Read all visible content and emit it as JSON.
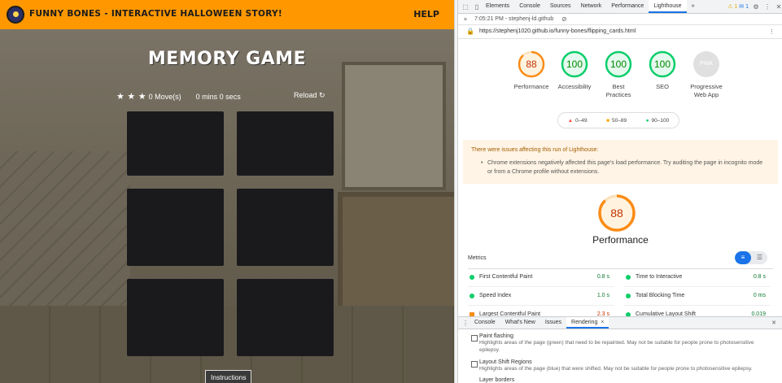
{
  "game": {
    "site_title": "Funny Bones - Interactive Halloween Story!",
    "help": "HELP",
    "title": "MEMORY GAME",
    "stars": [
      "★",
      "★",
      "★"
    ],
    "moves": "0 Move(s)",
    "timer": "0 mins 0 secs",
    "reload": "Reload ↻",
    "card_count": 6,
    "instructions_button": "Instructions"
  },
  "devtools": {
    "tabs": [
      "Elements",
      "Console",
      "Sources",
      "Network",
      "Performance",
      "Lighthouse"
    ],
    "active_tab": "Lighthouse",
    "more_tabs": "»",
    "warn_badge": "⚠ 1",
    "info_badge": "✉ 1",
    "report_time": "7:05:21 PM - stephenj-ld.github",
    "url": "https://stephenj1020.github.io/funny-bones/flipping_cards.html",
    "gauges": [
      {
        "score": "88",
        "label": "Performance",
        "color": "#fa8c16"
      },
      {
        "score": "100",
        "label": "Accessibility",
        "color": "#0cce6b"
      },
      {
        "score": "100",
        "label": "Best Practices",
        "color": "#0cce6b"
      },
      {
        "score": "100",
        "label": "SEO",
        "color": "#0cce6b"
      },
      {
        "score": "PWA",
        "label": "Progressive Web App",
        "color": "#cccccc"
      }
    ],
    "legend": {
      "low": "0–49",
      "mid": "50–89",
      "high": "90–100"
    },
    "warning_title": "There were issues affecting this run of Lighthouse:",
    "warning_item": "Chrome extensions negatively affected this page's load performance. Try auditing the page in incognito mode or from a Chrome profile without extensions.",
    "performance_score": "88",
    "performance_label": "Performance",
    "metrics_label": "Metrics",
    "metrics": [
      {
        "label": "First Contentful Paint",
        "value": "0.8 s",
        "color": "#0cce6b"
      },
      {
        "label": "Time to Interactive",
        "value": "0.8 s",
        "color": "#0cce6b"
      },
      {
        "label": "Speed Index",
        "value": "1.0 s",
        "color": "#0cce6b"
      },
      {
        "label": "Total Blocking Time",
        "value": "0 ms",
        "color": "#0cce6b"
      },
      {
        "label": "Largest Contentful Paint",
        "value": "2.3 s",
        "color": "#fa8c16"
      },
      {
        "label": "Cumulative Layout Shift",
        "value": "0.019",
        "color": "#0cce6b"
      }
    ],
    "drawer_tabs": [
      "Console",
      "What's New",
      "Issues",
      "Rendering"
    ],
    "drawer_active": "Rendering",
    "options": [
      {
        "title": "Paint flashing",
        "desc": "Highlights areas of the page (green) that need to be repainted. May not be suitable for people prone to photosensitive epilepsy."
      },
      {
        "title": "Layout Shift Regions",
        "desc": "Highlights areas of the page (blue) that were shifted. May not be suitable for people prone to photosensitive epilepsy."
      },
      {
        "title": "Layer borders",
        "desc": ""
      }
    ]
  }
}
